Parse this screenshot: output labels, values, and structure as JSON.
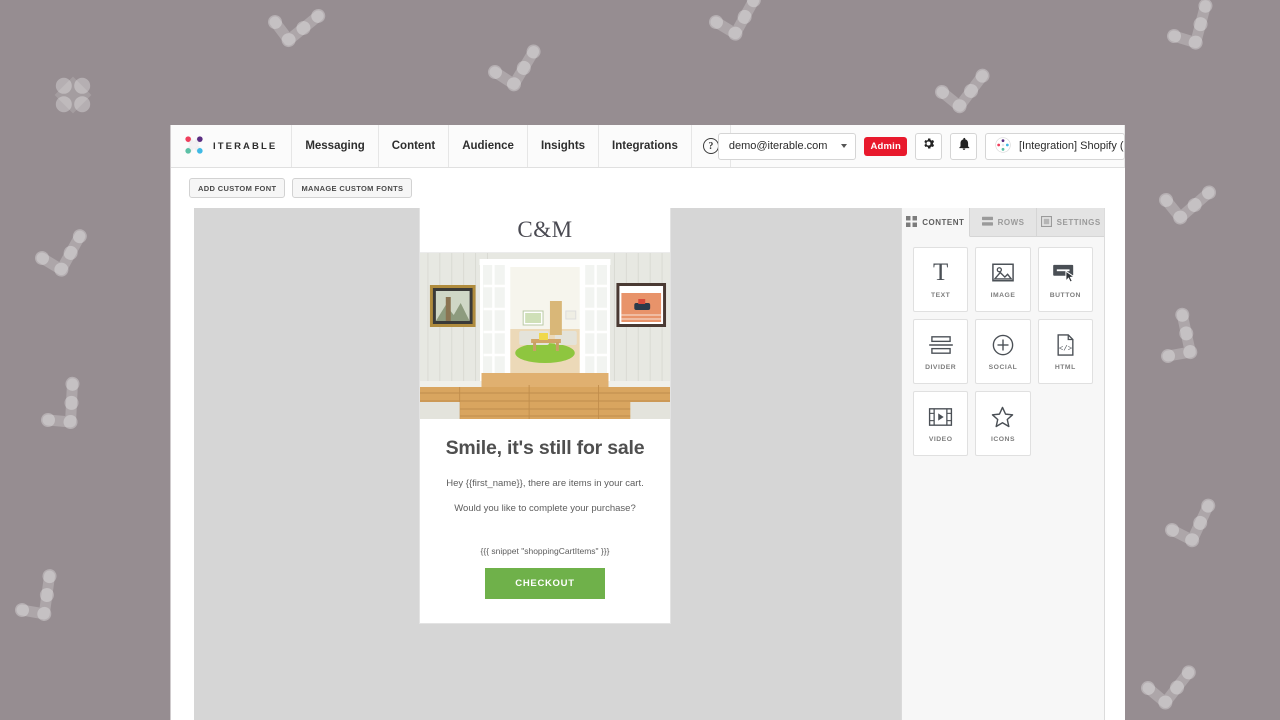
{
  "theme": {
    "page_bg": "#968d91",
    "accent_red": "#e8192c",
    "checkout_green": "#6fb14a",
    "canvas_grey": "#d6d6d6",
    "panel_grey": "#f7f7f7"
  },
  "top_nav": {
    "brand": "ITERABLE",
    "brand_icon": "iterable-logo-icon",
    "items": [
      {
        "label": "Messaging"
      },
      {
        "label": "Content"
      },
      {
        "label": "Audience"
      },
      {
        "label": "Insights"
      },
      {
        "label": "Integrations"
      }
    ],
    "help_icon": "question-mark-circle-icon",
    "help_glyph": "?",
    "account": {
      "email": "demo@iterable.com",
      "caret_icon": "chevron-down-icon"
    },
    "admin_badge": "Admin",
    "settings_icon": "gear-icon",
    "notifications_icon": "bell-icon",
    "project": {
      "label": "[Integration] Shopify (C",
      "icon": "project-dots-icon"
    }
  },
  "sub_toolbar": {
    "buttons": [
      {
        "label": "ADD CUSTOM FONT"
      },
      {
        "label": "MANAGE CUSTOM FONTS"
      }
    ]
  },
  "email_preview": {
    "logo": "C&M",
    "hero_alt": "interior-room-photo",
    "heading": "Smile, it's still for sale",
    "paragraph_1": "Hey {{first_name}}, there are items in your cart.",
    "paragraph_2": "Would you like to complete your purchase?",
    "snippet": "{{{ snippet \"shoppingCartItems\" }}}",
    "cta_label": "CHECKOUT"
  },
  "right_panel": {
    "tabs": [
      {
        "label": "CONTENT",
        "icon": "grid-squares-icon",
        "active": true
      },
      {
        "label": "ROWS",
        "icon": "rows-icon",
        "active": false
      },
      {
        "label": "SETTINGS",
        "icon": "panel-icon",
        "active": false
      }
    ],
    "blocks": [
      {
        "label": "TEXT",
        "icon": "text-t-icon"
      },
      {
        "label": "IMAGE",
        "icon": "image-icon"
      },
      {
        "label": "BUTTON",
        "icon": "button-cursor-icon"
      },
      {
        "label": "DIVIDER",
        "icon": "divider-icon"
      },
      {
        "label": "SOCIAL",
        "icon": "plus-circle-icon"
      },
      {
        "label": "HTML",
        "icon": "code-file-icon"
      },
      {
        "label": "VIDEO",
        "icon": "video-film-icon"
      },
      {
        "label": "ICONS",
        "icon": "star-icon"
      }
    ]
  }
}
